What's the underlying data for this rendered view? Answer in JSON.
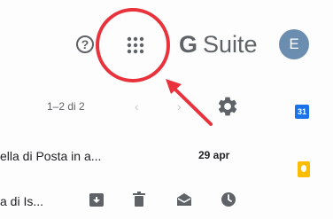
{
  "header": {
    "help_label": "?",
    "brand_g": "G",
    "brand_suite": "Suite",
    "avatar_initial": "E"
  },
  "toolbar": {
    "page_range": "1–2 di 2",
    "prev_glyph": "‹",
    "next_glyph": "›"
  },
  "rows": [
    {
      "sender": "ella di Posta in a...",
      "date": "29 apr"
    },
    {
      "sender": "a di Is...",
      "actions": [
        "archive-icon",
        "delete-icon",
        "mark-read-icon",
        "snooze-icon"
      ]
    }
  ],
  "side_panel": {
    "calendar_label": "31"
  },
  "colors": {
    "highlight": "#e8323c",
    "avatar_bg": "#6a8db0",
    "calendar": "#1a73e8",
    "keep": "#fbbc04",
    "icon_gray": "#5f6368"
  }
}
